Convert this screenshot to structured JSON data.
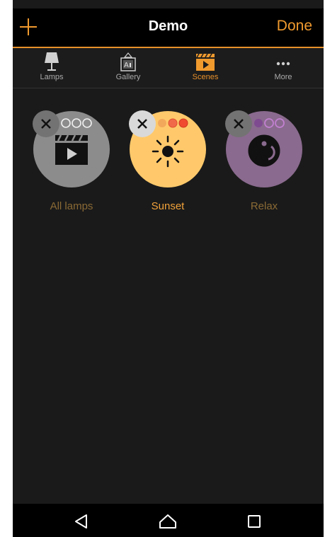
{
  "header": {
    "title": "Demo",
    "done_label": "Done",
    "add_icon": "plus-icon",
    "accent": "#f09a2e"
  },
  "tabs": [
    {
      "label": "Lamps",
      "icon": "lamp-icon",
      "active": false
    },
    {
      "label": "Gallery",
      "icon": "gallery-icon",
      "active": false
    },
    {
      "label": "Scenes",
      "icon": "scenes-icon",
      "active": true
    },
    {
      "label": "More",
      "icon": "more-icon",
      "active": false
    }
  ],
  "scenes": [
    {
      "name": "All lamps",
      "color": "#8c8c8c",
      "icon": "clapperboard-icon",
      "dot_colors": [
        "outline",
        "outline",
        "outline"
      ]
    },
    {
      "name": "Sunset",
      "color": "#ffc96b",
      "icon": "sun-icon",
      "dot_colors": [
        "#f2a85a",
        "#f06a4a",
        "#f04a30"
      ],
      "active": true
    },
    {
      "name": "Relax",
      "color": "#8a6a8e",
      "icon": "yin-yang-icon",
      "dot_colors": [
        "#7e4a90",
        "#c280d0",
        "#c280d0"
      ]
    }
  ],
  "system_nav": [
    "back-icon",
    "home-icon",
    "recents-icon"
  ]
}
